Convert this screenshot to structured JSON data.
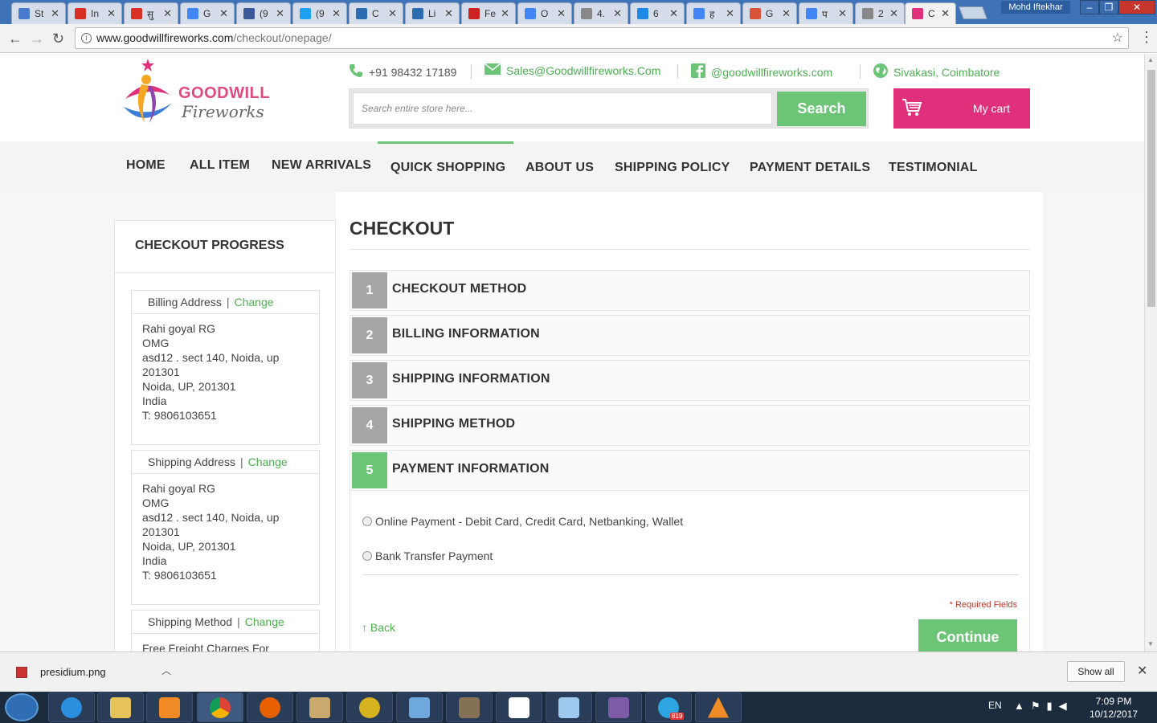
{
  "browser": {
    "tabs": [
      {
        "label": "St",
        "color": "#4a7bd0"
      },
      {
        "label": "In",
        "color": "#d93025"
      },
      {
        "label": "सु",
        "color": "#d93025"
      },
      {
        "label": "G",
        "color": "#4285f4"
      },
      {
        "label": "(9",
        "color": "#3b5998"
      },
      {
        "label": "(9",
        "color": "#1da1f2"
      },
      {
        "label": "C",
        "color": "#2b6cb0"
      },
      {
        "label": "Li",
        "color": "#2b6cb0"
      },
      {
        "label": "Fe",
        "color": "#cc2222"
      },
      {
        "label": "O",
        "color": "#4285f4"
      },
      {
        "label": "4.",
        "color": "#888888"
      },
      {
        "label": "6",
        "color": "#1e88e5"
      },
      {
        "label": "ह",
        "color": "#4285f4"
      },
      {
        "label": "G",
        "color": "#d8533a"
      },
      {
        "label": "प",
        "color": "#4285f4"
      },
      {
        "label": "2",
        "color": "#888888"
      },
      {
        "label": "C",
        "color": "#e0307c"
      }
    ],
    "user_name": "Mohd Iftekhar",
    "url_host": "www.goodwillfireworks.com",
    "url_path": "/checkout/onepage/"
  },
  "header": {
    "logo_line1": "GOODWILL",
    "logo_line2": "Fireworks",
    "phone": "+91 98432 17189",
    "email": "Sales@Goodwillfireworks.Com",
    "facebook": "@goodwillfireworks.com",
    "location": "Sivakasi, Coimbatore",
    "search_placeholder": "Search entire store here...",
    "search_button": "Search",
    "cart_label": "My cart"
  },
  "nav": {
    "items": [
      "HOME",
      "ALL ITEM",
      "NEW ARRIVALS",
      "QUICK SHOPPING",
      "ABOUT US",
      "SHIPPING POLICY",
      "PAYMENT DETAILS",
      "TESTIMONIAL"
    ]
  },
  "sidebar": {
    "title": "CHECKOUT PROGRESS",
    "sections": [
      {
        "heading": "Billing Address",
        "change": "Change",
        "lines": [
          "Rahi goyal RG",
          "OMG",
          "asd12 . sect 140, Noida, up",
          "201301",
          "Noida, UP, 201301",
          "India",
          "T: 9806103651"
        ]
      },
      {
        "heading": "Shipping Address",
        "change": "Change",
        "lines": [
          "Rahi goyal RG",
          "OMG",
          "asd12 . sect 140, Noida, up",
          "201301",
          "Noida, UP, 201301",
          "India",
          "T: 9806103651"
        ]
      },
      {
        "heading": "Shipping Method",
        "change": "Change",
        "lines": [
          "Free Freight Charges For"
        ]
      }
    ]
  },
  "checkout": {
    "title": "CHECKOUT",
    "steps": [
      {
        "num": "1",
        "label": "CHECKOUT METHOD"
      },
      {
        "num": "2",
        "label": "BILLING INFORMATION"
      },
      {
        "num": "3",
        "label": "SHIPPING INFORMATION"
      },
      {
        "num": "4",
        "label": "SHIPPING METHOD"
      },
      {
        "num": "5",
        "label": "PAYMENT INFORMATION"
      }
    ],
    "payment_options": [
      "Online Payment - Debit Card, Credit Card, Netbanking, Wallet",
      "Bank Transfer Payment"
    ],
    "required_note": "* Required Fields",
    "back_label": "Back",
    "continue_label": "Continue"
  },
  "downloads": {
    "file_name": "presidium.png",
    "show_all": "Show all"
  },
  "taskbar": {
    "language": "EN",
    "time": "7:09 PM",
    "date": "10/12/2017",
    "telegram_badge": "819"
  }
}
